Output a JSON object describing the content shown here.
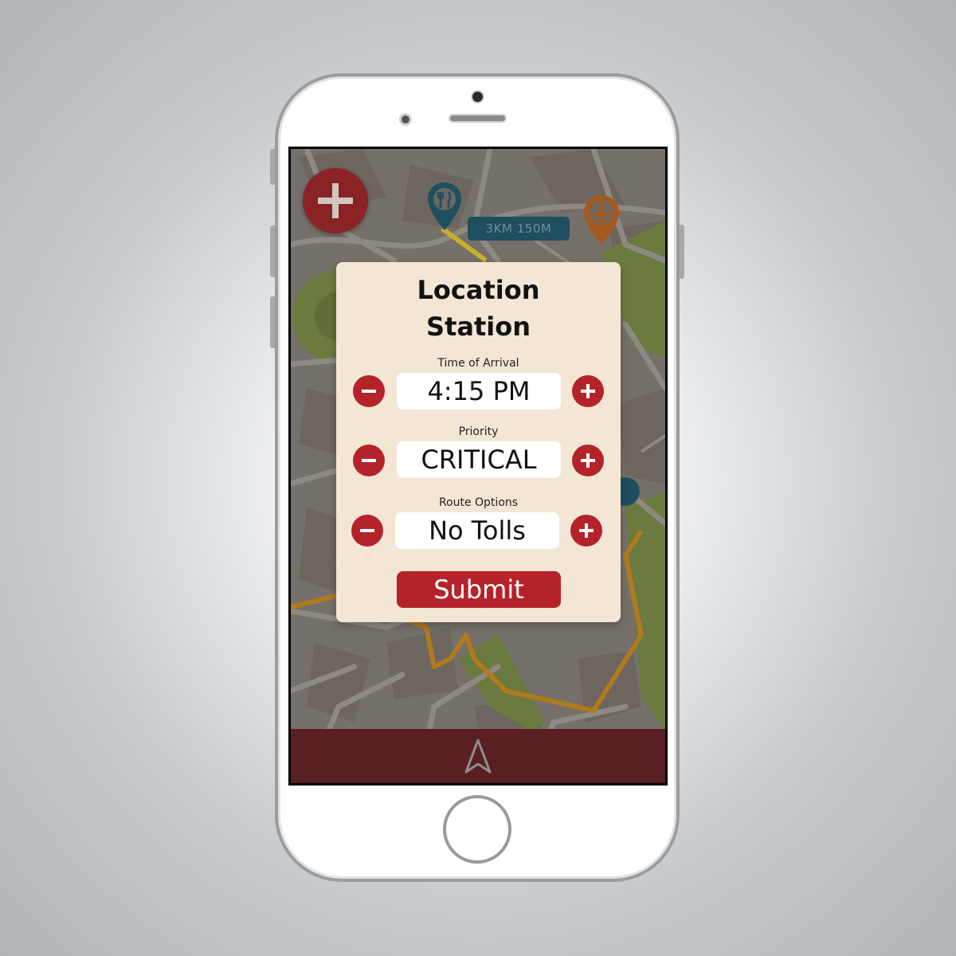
{
  "map": {
    "distance_badge": "3KM 150M",
    "pins": [
      {
        "name": "restaurant-pin",
        "icon": "fork-knife-icon",
        "color": "#1f4e5f"
      },
      {
        "name": "airport-pin",
        "icon": "airplane-icon",
        "color": "#a4591e"
      }
    ]
  },
  "fab": {
    "icon": "plus-icon",
    "color": "#8a2326"
  },
  "dialog": {
    "title_line1": "Location",
    "title_line2": "Station",
    "fields": [
      {
        "label": "Time of Arrival",
        "value": "4:15 PM"
      },
      {
        "label": "Priority",
        "value": "CRITICAL"
      },
      {
        "label": "Route Options",
        "value": "No Tolls"
      }
    ],
    "submit_label": "Submit"
  },
  "bottom_bar": {
    "icon": "navigation-arrow-icon",
    "color": "#591f22"
  },
  "colors": {
    "accent": "#b5232a",
    "dialog_bg": "#f3e6d5",
    "park": "#6b7a3e",
    "route": "#b07a1e"
  }
}
